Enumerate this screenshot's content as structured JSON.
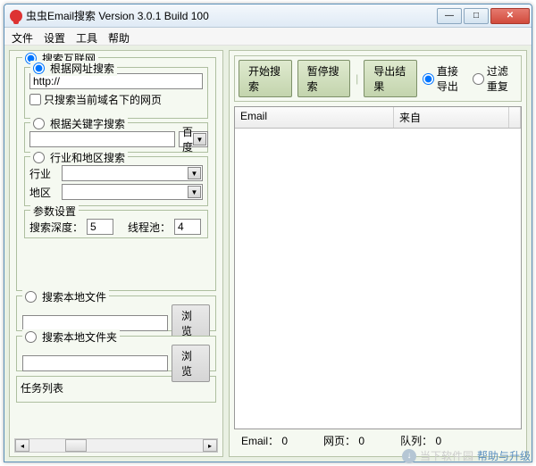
{
  "window": {
    "title": "虫虫Email搜索 Version 3.0.1 Build 100"
  },
  "menu": {
    "file": "文件",
    "settings": "设置",
    "tools": "工具",
    "help": "帮助"
  },
  "left": {
    "search_internet": "搜索互联网",
    "by_url": "根据网址搜索",
    "url_value": "http://",
    "only_current_domain": "只搜索当前域名下的网页",
    "by_keyword": "根据关键字搜索",
    "keyword_engine": "百度",
    "by_industry": "行业和地区搜索",
    "industry_label": "行业",
    "region_label": "地区",
    "params_label": "参数设置",
    "depth_label": "搜索深度：",
    "depth_value": "5",
    "threads_label": "线程池：",
    "threads_value": "4",
    "search_file": "搜索本地文件",
    "search_folder": "搜索本地文件夹",
    "browse": "浏览",
    "task_list": "任务列表"
  },
  "right": {
    "start": "开始搜索",
    "pause": "暂停搜索",
    "export": "导出结果",
    "direct_export": "直接导出",
    "filter_dup": "过滤重复",
    "col_email": "Email",
    "col_from": "来自",
    "status_email": "Email：",
    "status_email_v": "0",
    "status_pages": "网页：",
    "status_pages_v": "0",
    "status_queue": "队列：",
    "status_queue_v": "0"
  },
  "footer": {
    "watermark": "当下软件园",
    "help_upgrade": "帮助与升级"
  }
}
